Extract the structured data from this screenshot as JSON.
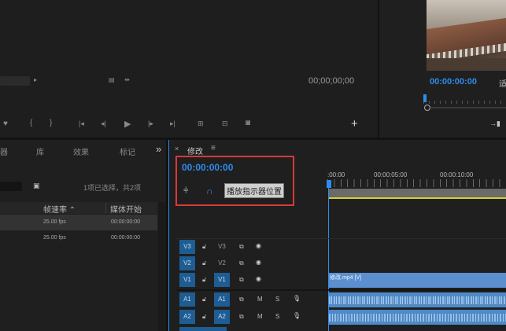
{
  "source_monitor": {
    "timecode": "00;00;00;00"
  },
  "program_monitor": {
    "timecode": "00:00:00:00",
    "timecode_right_fragment": "适"
  },
  "project_panel": {
    "tabs": [
      "器",
      "库",
      "效果",
      "标记"
    ],
    "more": "»",
    "selection_status": "1项已选择，共2项",
    "columns": [
      "帧速率",
      "媒体开始"
    ],
    "rows": [
      {
        "fps": "25.00 fps",
        "media_start": "00:00:00:00"
      },
      {
        "fps": "25.00 fps",
        "media_start": "00:00:00:00"
      }
    ]
  },
  "timeline": {
    "close": "×",
    "title": "修改",
    "menu": "≡",
    "timecode": "00:00:00:00",
    "tooltip": "播放指示器位置",
    "ruler_labels": [
      ":00:00",
      "00:00:05:00",
      "00:00:10:00"
    ],
    "tracks": [
      {
        "name": "V3",
        "target": "V3",
        "type": "video"
      },
      {
        "name": "V2",
        "target": "V2",
        "type": "video"
      },
      {
        "name": "V1",
        "target": "V1",
        "type": "video"
      },
      {
        "name": "A1",
        "target": "A1",
        "type": "audio"
      },
      {
        "name": "A2",
        "target": "A2",
        "type": "audio"
      }
    ],
    "mute": "M",
    "solo": "S",
    "video_clip_label": "修改.mp4 [V]"
  },
  "colors": {
    "accent_blue": "#2d8ceb",
    "highlight_red": "#d83a3a",
    "clip_blue": "#5c8fd0",
    "playhead_yellow": "#d6d22a"
  }
}
